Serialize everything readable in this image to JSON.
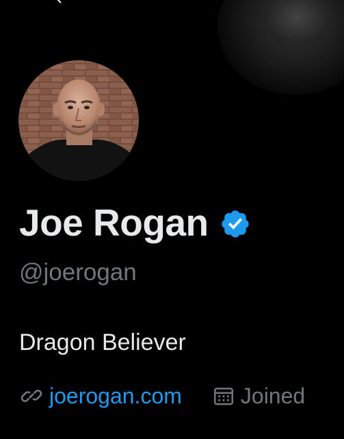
{
  "profile": {
    "display_name": "Joe Rogan",
    "handle": "@joerogan",
    "bio": "Dragon Believer",
    "website": "joerogan.com",
    "joined_label": "Joined",
    "verified": true
  },
  "icons": {
    "back": "back-arrow-icon",
    "verified": "verified-badge-icon",
    "link": "link-icon",
    "calendar": "calendar-icon"
  },
  "colors": {
    "background": "#000000",
    "name": "#e7e9ea",
    "secondary": "#71767b",
    "link": "#1d9bf0",
    "verified": "#1d9bf0"
  }
}
